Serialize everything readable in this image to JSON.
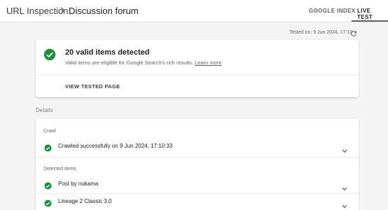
{
  "header": {
    "breadcrumb_root": "URL Inspection",
    "breadcrumb_current": "Discussion forum",
    "tabs": [
      {
        "label": "GOOGLE INDEX",
        "active": false
      },
      {
        "label": "LIVE TEST",
        "active": true
      }
    ]
  },
  "tested_on": "Tested on: 9 Jun 2024, 17:10",
  "summary": {
    "title": "20 valid items detected",
    "subtitle": "Valid items are eligible for Google Search's rich results.",
    "learn_more": "Learn more",
    "view_tested_page": "VIEW TESTED PAGE"
  },
  "details": {
    "label": "Details",
    "crawl": {
      "label": "Crawl",
      "item": "Crawled successfully on 9 Jun 2024, 17:10:33"
    },
    "detected": {
      "label": "Detected items",
      "items": [
        "Post by nukama",
        "Lineage 2 Classic 3.0"
      ]
    }
  },
  "colors": {
    "success_green": "#1e8e3e",
    "text_primary": "#202124",
    "text_secondary": "#5f6368"
  },
  "icons": {
    "breadcrumb_separator": "chevron-right-icon",
    "refresh": "refresh-icon",
    "status": "check-circle-icon",
    "expand": "chevron-down-icon"
  }
}
